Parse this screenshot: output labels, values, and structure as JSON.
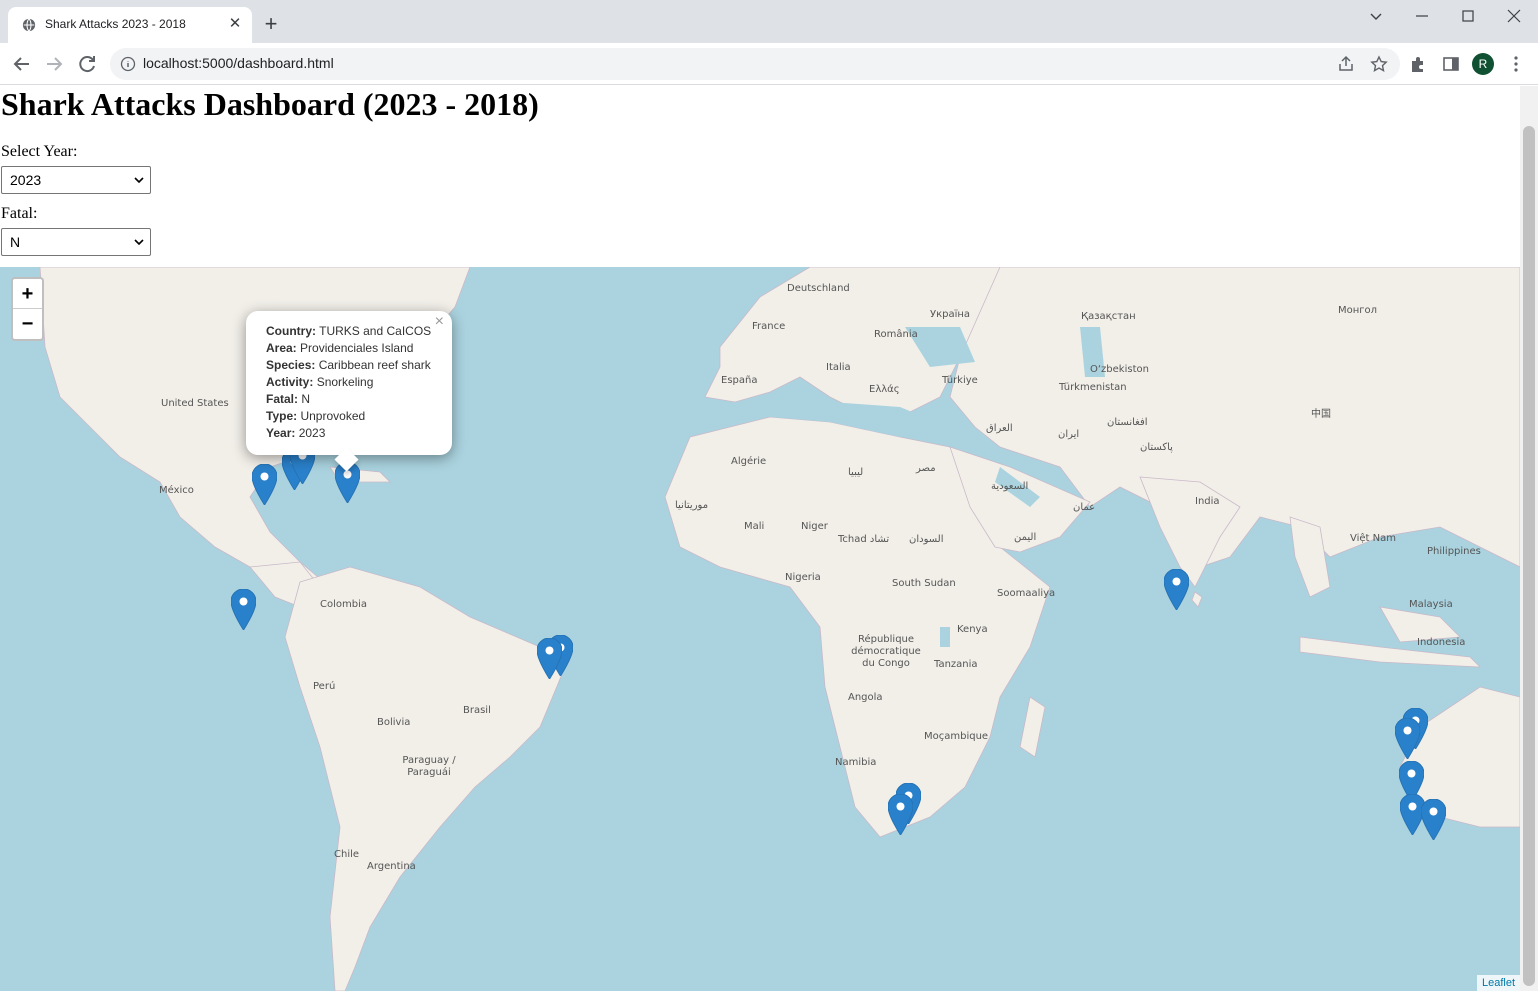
{
  "browser": {
    "tab_title": "Shark Attacks 2023 - 2018",
    "url": "localhost:5000/dashboard.html",
    "avatar_letter": "R"
  },
  "page": {
    "title": "Shark Attacks Dashboard (2023 - 2018)",
    "year_label": "Select Year:",
    "year_value": "2023",
    "fatal_label": "Fatal:",
    "fatal_value": "N"
  },
  "map": {
    "zoom_in": "+",
    "zoom_out": "−",
    "attribution": "Leaflet",
    "country_labels": [
      "Deutschland",
      "France",
      "España",
      "Italia",
      "România",
      "Україна",
      "Қазақстан",
      "Монгол",
      "United States",
      "México",
      "Colombia",
      "Perú",
      "Brasil",
      "Bolivia",
      "Paraguay / Paraguái",
      "Chile",
      "Argentina",
      "Algérie",
      "Mali",
      "Niger",
      "Nigeria",
      "Angola",
      "Namibia",
      "South Sudan",
      "Kenya",
      "Tanzania",
      "Moçambique",
      "India",
      "Philippines",
      "Malaysia",
      "Indonesia",
      "Türkiye",
      "Ελλάς",
      "Türkmenistan",
      "O‘zbekiston",
      "Việt Nam",
      "中国",
      "ليبيا",
      "مصر",
      "السودان",
      "Tchad تشاد",
      "République démocratique du Congo",
      "Soomaaliya",
      "العراق",
      "ايران",
      "افغانستان",
      "پاکستان",
      "السعودية",
      "اليمن",
      "عمان",
      "موريتانيا"
    ],
    "popup": {
      "country_label": "Country:",
      "country": "TURKS and CaICOS",
      "area_label": "Area:",
      "area": "Providenciales Island",
      "species_label": "Species:",
      "species": "Caribbean reef shark",
      "activity_label": "Activity:",
      "activity": "Snorkeling",
      "fatal_label": "Fatal:",
      "fatal": "N",
      "type_label": "Type:",
      "type": "Unprovoked",
      "year_label": "Year:",
      "year": "2023",
      "close": "×"
    }
  },
  "colors": {
    "marker": "#2a81cb",
    "water": "#aad3df",
    "land": "#f2efe9"
  }
}
